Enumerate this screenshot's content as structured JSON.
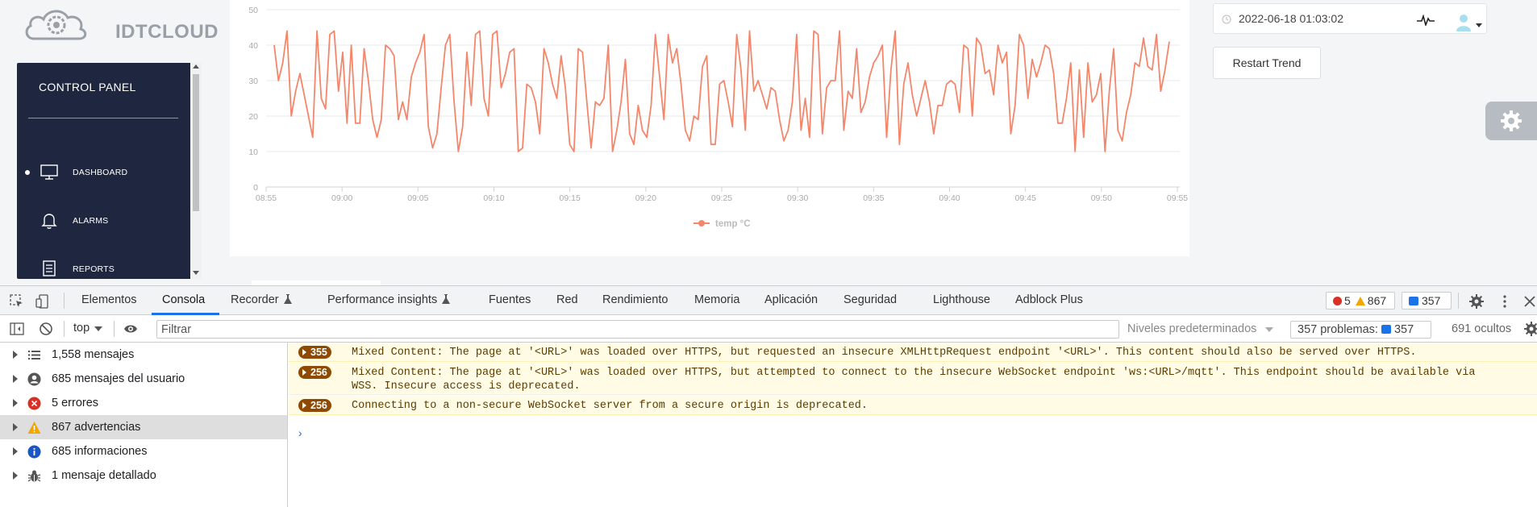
{
  "app": {
    "logo_text": "IDTCLOUD",
    "sidebar": {
      "title": "CONTROL PANEL",
      "items": [
        {
          "label": "DASHBOARD",
          "icon": "monitor-icon",
          "active": true
        },
        {
          "label": "ALARMS",
          "icon": "bell-icon",
          "active": false
        },
        {
          "label": "REPORTS",
          "icon": "report-icon",
          "active": false
        }
      ]
    },
    "date_text": "2022-06-18 01:03:02",
    "restart_label": "Restart Trend",
    "colors": {
      "series": "#f4866b",
      "sidebar_bg": "#1f2740",
      "accent": "#1a73e8"
    }
  },
  "chart_data": {
    "type": "line",
    "x_ticks": [
      "08:55",
      "09:00",
      "09:05",
      "09:10",
      "09:15",
      "09:20",
      "09:25",
      "09:30",
      "09:35",
      "09:40",
      "09:45",
      "09:50",
      "09:55"
    ],
    "y_ticks": [
      "0",
      "10",
      "20",
      "30",
      "40",
      "50"
    ],
    "ylim": [
      0,
      50
    ],
    "grid": true,
    "legend_position": "bottom",
    "series": [
      {
        "name": "temp °C",
        "values": [
          40,
          30,
          35,
          44,
          20,
          27,
          32,
          26,
          20,
          14,
          44,
          25,
          22,
          43,
          44,
          27,
          38,
          18,
          40,
          18,
          18,
          39,
          30,
          19,
          14,
          19,
          40,
          39,
          37,
          19,
          24,
          19,
          31,
          35,
          38,
          43,
          17,
          11,
          15,
          28,
          40,
          43,
          24,
          10,
          17,
          38,
          23,
          43,
          44,
          25,
          20,
          43,
          44,
          28,
          32,
          38,
          39,
          10,
          11,
          29,
          28,
          24,
          15,
          39,
          35,
          29,
          25,
          37,
          28,
          12,
          10,
          39,
          38,
          24,
          11,
          24,
          23,
          25,
          40,
          10,
          16,
          24,
          36,
          15,
          12,
          23,
          16,
          14,
          23,
          43,
          31,
          19,
          43,
          35,
          39,
          29,
          16,
          13,
          20,
          19,
          34,
          37,
          12,
          12,
          29,
          30,
          24,
          17,
          43,
          33,
          16,
          44,
          27,
          30,
          26,
          22,
          28,
          27,
          19,
          13,
          16,
          24,
          43,
          16,
          25,
          14,
          44,
          43,
          15,
          28,
          30,
          30,
          44,
          16,
          27,
          25,
          39,
          21,
          24,
          31,
          35,
          37,
          40,
          14,
          33,
          44,
          12,
          29,
          35,
          26,
          20,
          25,
          30,
          24,
          15,
          23,
          23,
          29,
          30,
          29,
          21,
          40,
          39,
          20,
          42,
          40,
          32,
          33,
          26,
          40,
          35,
          38,
          15,
          23,
          43,
          40,
          25,
          36,
          31,
          35,
          40,
          39,
          32,
          18,
          18,
          25,
          35,
          10,
          33,
          14,
          35,
          24,
          26,
          32,
          10,
          27,
          39,
          16,
          13,
          21,
          26,
          35,
          34,
          42,
          34,
          33,
          43,
          27,
          33,
          41
        ]
      }
    ]
  },
  "devtools": {
    "tabs": [
      "Elementos",
      "Consola",
      "Recorder",
      "Performance insights",
      "Fuentes",
      "Red",
      "Rendimiento",
      "Memoria",
      "Aplicación",
      "Seguridad",
      "Lighthouse",
      "Adblock Plus"
    ],
    "active_tab": "Consola",
    "error_count": "5",
    "warning_count": "867",
    "message_count": "357",
    "context": "top",
    "filter_placeholder": "Filtrar",
    "levels_label": "Niveles predeterminados",
    "problems_label": "357 problemas:",
    "problems_count": "357",
    "hidden_label": "691 ocultos",
    "sidebar_items": [
      {
        "label": "1,558 mensajes",
        "icon": "list-icon"
      },
      {
        "label": "685 mensajes del usuario",
        "icon": "user-circle-icon"
      },
      {
        "label": "5 errores",
        "icon": "error-icon"
      },
      {
        "label": "867 advertencias",
        "icon": "warning-icon"
      },
      {
        "label": "685 informaciones",
        "icon": "info-icon"
      },
      {
        "label": "1 mensaje detallado",
        "icon": "bug-icon"
      }
    ],
    "messages": [
      {
        "count": "355",
        "text": "Mixed Content: The page at '<URL>' was loaded over HTTPS, but requested an insecure XMLHttpRequest endpoint '<URL>'. This content should also be served over HTTPS."
      },
      {
        "count": "256",
        "text": "Mixed Content: The page at '<URL>' was loaded over HTTPS, but attempted to connect to the insecure WebSocket endpoint 'ws:<URL>/mqtt'. This endpoint should be available via",
        "text2": "WSS. Insecure access is deprecated."
      },
      {
        "count": "256",
        "text": "Connecting to a non-secure WebSocket server from a secure origin is deprecated."
      }
    ],
    "prompt": "›"
  }
}
